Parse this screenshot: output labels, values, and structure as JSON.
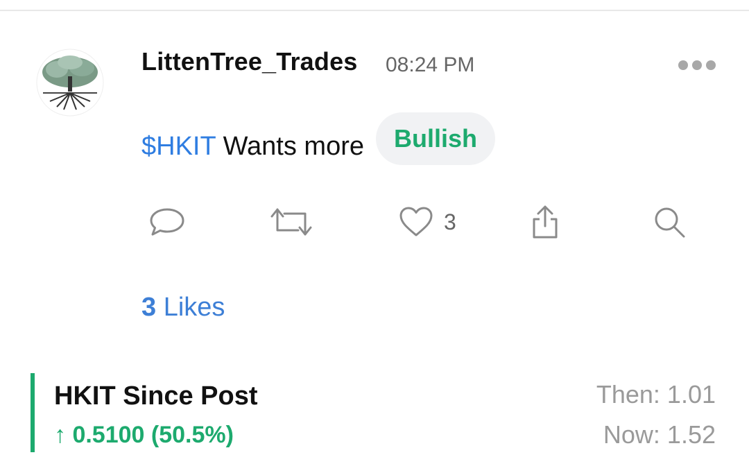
{
  "post": {
    "username": "LittenTree_Trades",
    "time": "08:24 PM",
    "cashtag": "$HKIT",
    "text": " Wants more",
    "sentiment": "Bullish",
    "like_count": "3",
    "likes_summary_count": "3",
    "likes_summary_label": " Likes"
  },
  "icons": {
    "more": "more-dots-icon",
    "reply": "comment-icon",
    "reshare": "repost-icon",
    "like": "heart-icon",
    "share": "share-icon",
    "search": "search-icon"
  },
  "performance": {
    "title": "HKIT Since Post",
    "change": "↑ 0.5100 (50.5%)",
    "then": "Then: 1.01",
    "now": "Now: 1.52"
  },
  "colors": {
    "bullish": "#1daa6e",
    "link": "#2f7de1",
    "muted": "#9a9a9a"
  }
}
